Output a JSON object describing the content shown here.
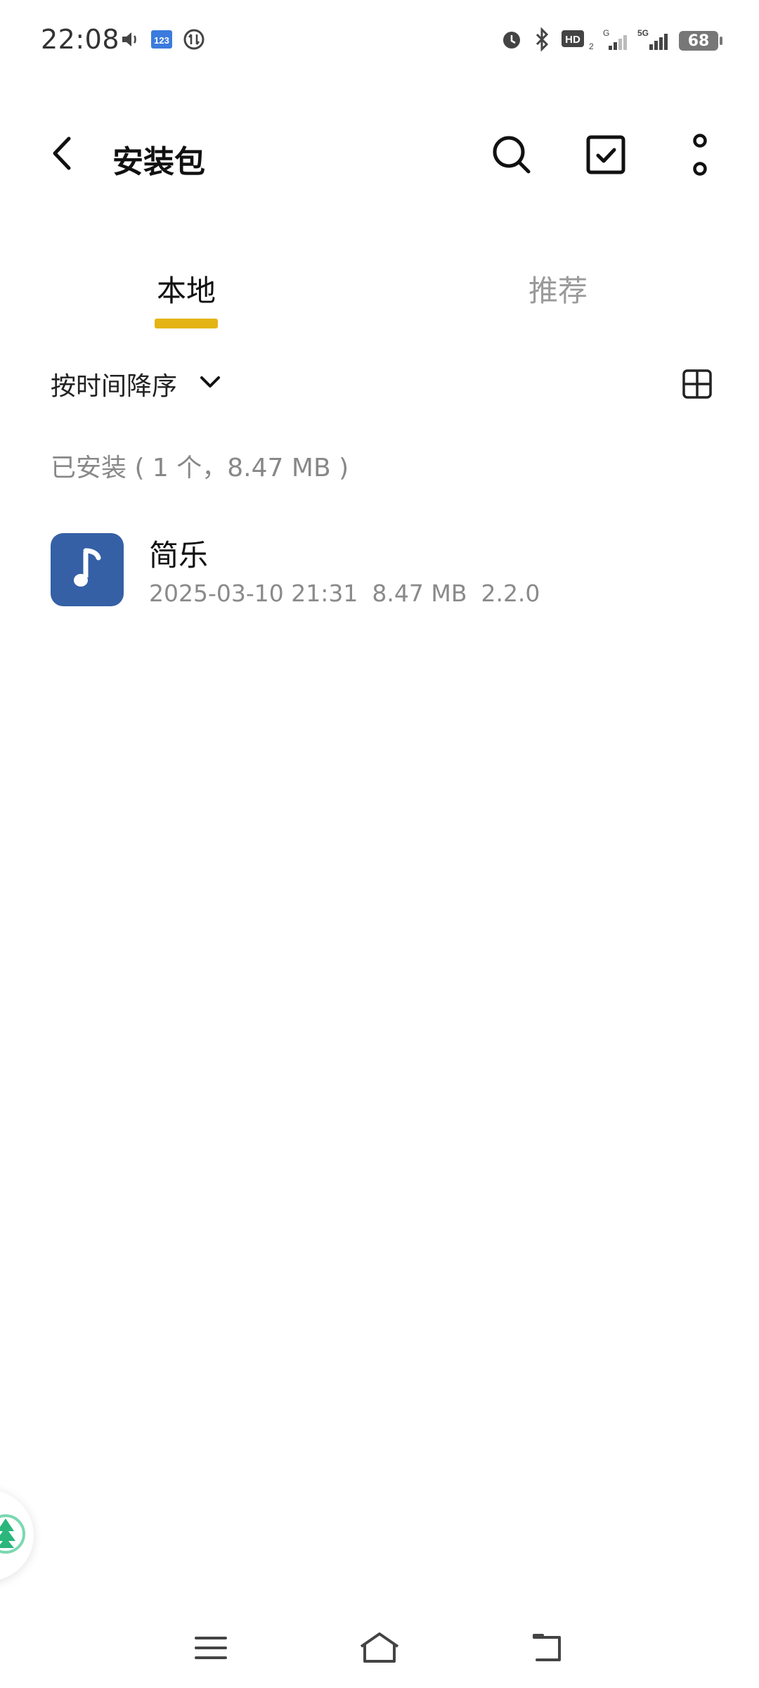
{
  "status_bar": {
    "time": "22:08",
    "battery_level": "68",
    "left_icons": [
      "volume-icon",
      "keyboard-123-icon",
      "data-sync-icon"
    ],
    "right_icons": [
      "alarm-icon",
      "bluetooth-icon",
      "hd-volte-icon",
      "signal-g-icon",
      "signal-5g-icon",
      "battery-icon"
    ]
  },
  "app_bar": {
    "title": "安装包",
    "actions": [
      "search-icon",
      "select-checkbox-icon",
      "more-vert-icon"
    ]
  },
  "tabs": {
    "local": "本地",
    "recommend": "推荐",
    "active": "local",
    "accent": "#E3B414"
  },
  "sort": {
    "label": "按时间降序"
  },
  "section": {
    "header": "已安装 ( 1 个，8.47 MB )"
  },
  "items": [
    {
      "name": "简乐",
      "date": "2025-03-10 21:31",
      "size": "8.47 MB",
      "version": "2.2.0",
      "icon": "music-note-icon",
      "icon_bg": "#3560A6"
    }
  ],
  "nav_bar": {
    "buttons": [
      "menu-icon",
      "home-icon",
      "back-icon"
    ]
  },
  "floating_bubble": {
    "icon": "tree-icon",
    "color": "#2BB67B"
  }
}
